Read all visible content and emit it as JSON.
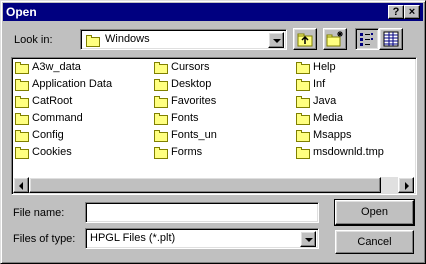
{
  "window": {
    "title": "Open",
    "help_label": "?",
    "close_label": "×"
  },
  "look_in": {
    "label": "Look in:",
    "value": "Windows"
  },
  "files": {
    "col1": [
      "A3w_data",
      "Application Data",
      "CatRoot",
      "Command",
      "Config",
      "Cookies"
    ],
    "col2": [
      "Cursors",
      "Desktop",
      "Favorites",
      "Fonts",
      "Fonts_un",
      "Forms"
    ],
    "col3": [
      {
        "name": "Help",
        "icon": "folder"
      },
      {
        "name": "Inf",
        "icon": "folder"
      },
      {
        "name": "Java",
        "icon": "folder"
      },
      {
        "name": "Media",
        "icon": "folder"
      },
      {
        "name": "Msapps",
        "icon": "folder"
      },
      {
        "name": "msdownld.tmp",
        "icon": "folder"
      }
    ]
  },
  "file_name": {
    "label": "File name:",
    "value": ""
  },
  "file_type": {
    "label": "Files of type:",
    "value": "HPGL Files (*.plt)"
  },
  "buttons": {
    "open": "Open",
    "cancel": "Cancel"
  },
  "colors": {
    "titlebar": "#000080",
    "face": "#c0c0c0",
    "folder": "#ffff80"
  }
}
